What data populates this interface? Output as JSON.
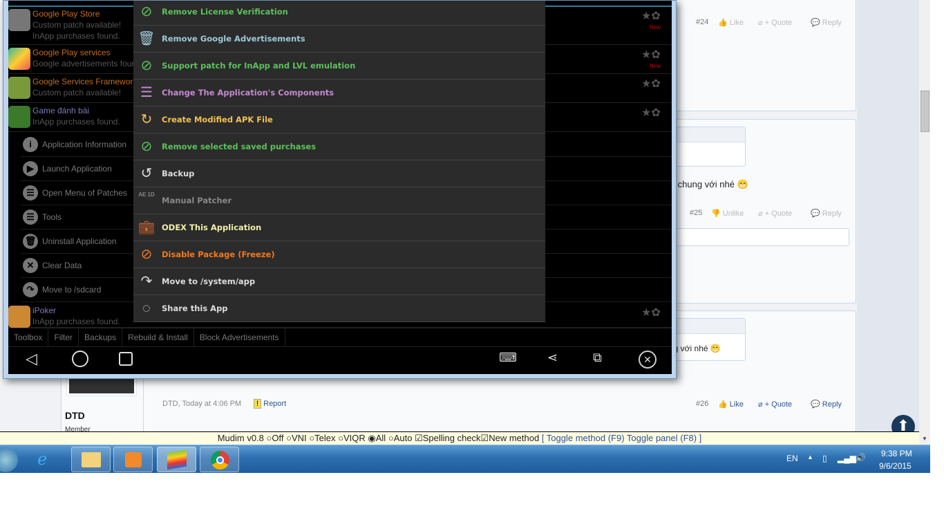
{
  "forum": {
    "posts": [
      {
        "number": "#24",
        "like": "Like",
        "quote": "+ Quote",
        "reply": "Reply"
      },
      {
        "number": "#25",
        "like": "Unlike",
        "quote": "+ Quote",
        "reply": "Reply",
        "text": "eat chung với nhé"
      },
      {
        "number": "#26",
        "like": "Like",
        "quote": "+ Quote",
        "reply": "Reply",
        "quote_text": "ng với nhé",
        "author": "DTD",
        "role": "Member",
        "meta": "DTD, Today at 4:06 PM",
        "report": "Report"
      }
    ]
  },
  "emulator": {
    "apps": [
      {
        "name": "Google Play Store",
        "lines": [
          "Custom patch available!",
          "InApp purchases found."
        ],
        "badge": "New",
        "name_color": "#c36d17"
      },
      {
        "name": "Google Play services",
        "lines": [
          "Google advertisements found"
        ],
        "badge": "New",
        "name_color": "#c36d17"
      },
      {
        "name": "Google Services Framework",
        "lines": [
          "Custom patch available!"
        ],
        "name_color": "#c36d17"
      },
      {
        "name": "Game đánh bài",
        "lines": [
          "InApp purchases found."
        ],
        "name_color": "#7a7ab8"
      },
      {
        "name": "iPoker",
        "lines": [
          "InApp purchases found."
        ],
        "name_color": "#7a7ab8"
      }
    ],
    "submenu": [
      {
        "label": "Application Information",
        "icon": "info-icon",
        "glyph": "i"
      },
      {
        "label": "Launch Application",
        "icon": "play-icon",
        "glyph": "▶"
      },
      {
        "label": "Open Menu of Patches",
        "icon": "list-icon",
        "glyph": "☰"
      },
      {
        "label": "Tools",
        "icon": "list-icon",
        "glyph": "☰"
      },
      {
        "label": "Uninstall Application",
        "icon": "trash-icon",
        "glyph": "🗑"
      },
      {
        "label": "Clear Data",
        "icon": "clear-icon",
        "glyph": "✕"
      },
      {
        "label": "Move to /sdcard",
        "icon": "move-icon",
        "glyph": "↷"
      }
    ],
    "menu": [
      {
        "label": "Remove License Verification",
        "color": "#5cc15c",
        "icon": "no-key-icon",
        "glyph": "⊘"
      },
      {
        "label": "Remove Google Advertisements",
        "color": "#9fc9d9",
        "icon": "trash-icon",
        "glyph": "🗑"
      },
      {
        "label": "Support patch for InApp and LVL emulation",
        "color": "#5cc15c",
        "icon": "no-key-icon",
        "glyph": "⊘"
      },
      {
        "label": "Change The Application's Components",
        "color": "#c58ad0",
        "icon": "components-icon",
        "glyph": "☰"
      },
      {
        "label": "Create Modified APK File",
        "color": "#f2c055",
        "icon": "apk-icon",
        "glyph": "↻"
      },
      {
        "label": "Remove selected saved purchases",
        "color": "#5cc15c",
        "icon": "no-key-icon",
        "glyph": "⊘"
      },
      {
        "label": "Backup",
        "color": "#dddddd",
        "icon": "backup-icon",
        "glyph": "↺"
      },
      {
        "label": "Manual Patcher",
        "color": "#888888",
        "icon": "hex-icon",
        "glyph": "AE 1D"
      },
      {
        "label": "ODEX This Application",
        "color": "#f4f0a8",
        "icon": "toolbox-icon",
        "glyph": "💼"
      },
      {
        "label": "Disable Package (Freeze)",
        "color": "#f07a1e",
        "icon": "freeze-icon",
        "glyph": "⊘"
      },
      {
        "label": "Move to /system/app",
        "color": "#dddddd",
        "icon": "move-icon",
        "glyph": "↷"
      },
      {
        "label": "Share this App",
        "color": "#dddddd",
        "icon": "share-icon",
        "glyph": "◌"
      }
    ],
    "tabs": [
      "Toolbox",
      "Filter",
      "Backups",
      "Rebuild & Install",
      "Block Advertisements"
    ]
  },
  "mudim": {
    "version": "Mudim v0.8",
    "options": [
      "Off",
      "VNI",
      "Telex",
      "VIQR",
      "All",
      "Auto"
    ],
    "selected": "All",
    "checks": [
      "Spelling check",
      "New method"
    ],
    "toggles": "[ Toggle method (F9) Toggle panel (F8) ]"
  },
  "taskbar": {
    "lang": "EN",
    "time": "9:38 PM",
    "date": "9/6/2015"
  }
}
